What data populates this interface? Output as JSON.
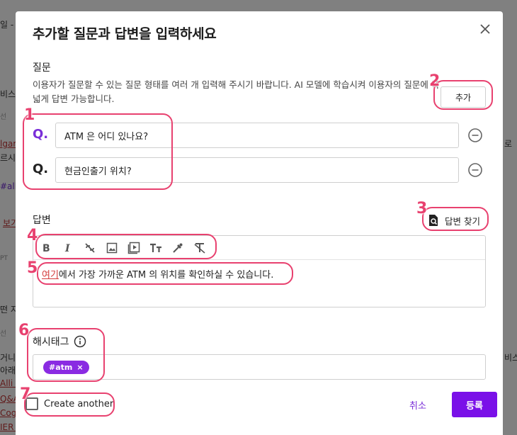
{
  "background": {
    "snippets": [
      "일 -",
      "비스",
      "선",
      "lgar",
      "르시",
      "#all",
      "보기",
      "PT",
      "선",
      "떤 지",
      "선",
      "거니",
      "아래",
      "Alli -",
      "Q&A",
      "Cogr",
      "IER API",
      "로",
      "비스"
    ]
  },
  "modal": {
    "title": "추가할 질문과 답변을 입력하세요",
    "question_section": {
      "label": "질문",
      "description": "이용자가 질문할 수 있는 질문 형태를 여러 개 입력해 주시기 바랍니다. AI 모델에 학습시켜 이용자의 질문에 폭 넓게 답변 가능합니다.",
      "add_label": "추가",
      "questions": [
        {
          "mark": "Q.",
          "value": "ATM 은 어디 있나요?",
          "mark_color": "#7a2fd8"
        },
        {
          "mark": "Q.",
          "value": "현금인출기 위치?",
          "mark_color": "#222222"
        }
      ]
    },
    "answer_section": {
      "label": "답변",
      "find_answer_label": "답변 찾기",
      "toolbar": [
        "bold-icon",
        "italic-icon",
        "link-off-icon",
        "image-icon",
        "video-icon",
        "text-size-icon",
        "color-picker-icon",
        "clear-format-icon"
      ],
      "body_link_text": "여기",
      "body_text": "에서 가장 가까운 ATM 의 위치를 확인하실 수 있습니다."
    },
    "hashtag_section": {
      "label": "해시태그",
      "tags": [
        "#atm"
      ],
      "chip_remove": "×"
    },
    "footer": {
      "create_another_label": "Create another",
      "create_another_checked": false,
      "cancel_label": "취소",
      "submit_label": "등록"
    }
  },
  "annotations": [
    "1",
    "2",
    "3",
    "4",
    "5",
    "6",
    "7"
  ],
  "colors": {
    "accent": "#7a10e8",
    "annotation": "#e8416f",
    "chip": "#8a2be2"
  }
}
